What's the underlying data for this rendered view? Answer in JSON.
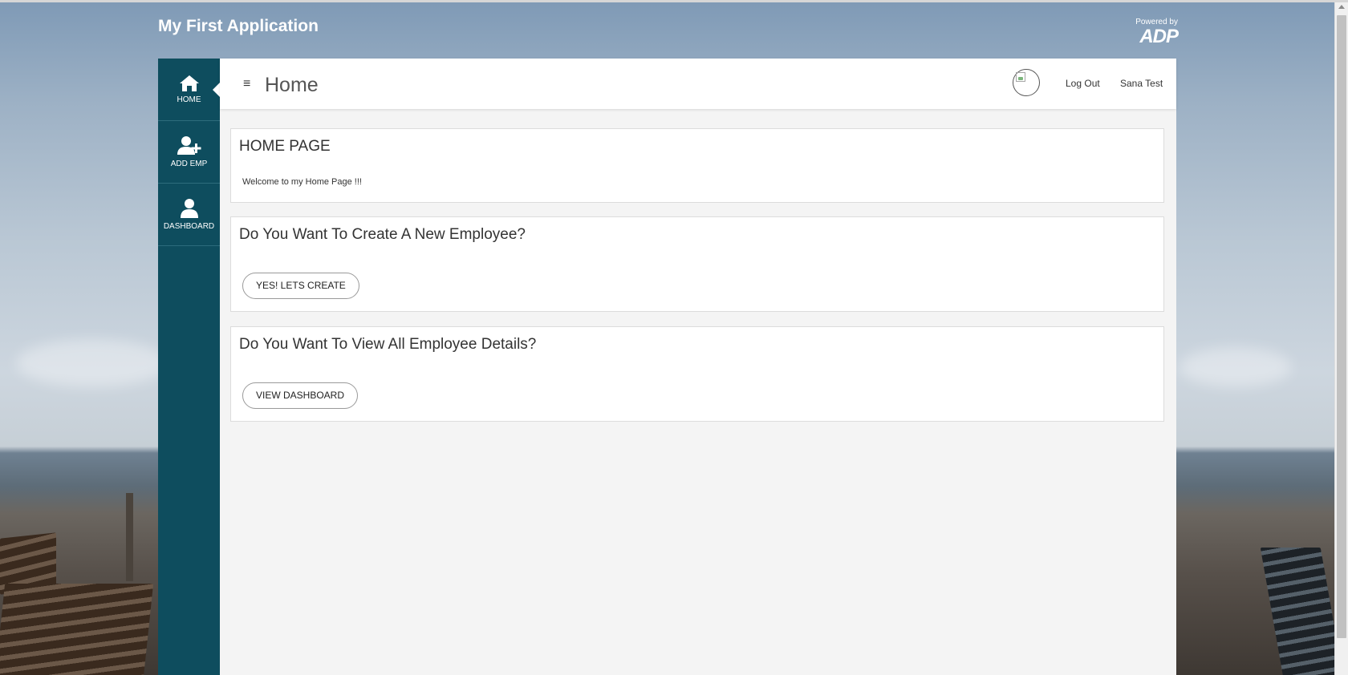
{
  "app": {
    "title": "My First Application",
    "powered_by": "Powered by",
    "brand_logo": "ADP"
  },
  "sidebar": {
    "items": [
      {
        "label": "HOME",
        "icon": "home-icon",
        "active": true
      },
      {
        "label": "ADD EMP",
        "icon": "add-user-icon",
        "active": false
      },
      {
        "label": "DASHBOARD",
        "icon": "user-icon",
        "active": false
      }
    ]
  },
  "topbar": {
    "title": "Home",
    "logout_label": "Log Out",
    "username": "Sana Test"
  },
  "cards": {
    "home": {
      "title": "HOME PAGE",
      "text": "Welcome to my Home Page !!!"
    },
    "create": {
      "title": "Do You Want To Create A New Employee?",
      "button": "YES! LETS CREATE"
    },
    "view": {
      "title": "Do You Want To View All Employee Details?",
      "button": "VIEW DASHBOARD"
    }
  },
  "colors": {
    "sidebar_bg": "#0e4d5e",
    "content_bg": "#f4f4f4",
    "card_bg": "#ffffff"
  }
}
